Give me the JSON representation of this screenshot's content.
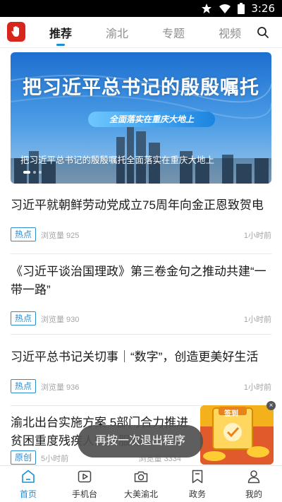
{
  "status_bar": {
    "time": "3:26"
  },
  "nav": {
    "tabs": [
      {
        "label": "推荐"
      },
      {
        "label": "渝北"
      },
      {
        "label": "专题"
      },
      {
        "label": "视频"
      }
    ],
    "active_tab": "推荐",
    "logo_icon": "red-hand-logo-icon",
    "search_icon": "search-icon"
  },
  "banner": {
    "headline": "把习近平总书记的殷殷嘱托",
    "ribbon": "全面落实在重庆大地上",
    "caption": "把习近平总书记的殷殷嘱托全面落实在重庆大地上"
  },
  "news": [
    {
      "title": "习近平就朝鲜劳动党成立75周年向金正恩致贺电",
      "tag": "热点",
      "views": "浏览量 925",
      "time": "1小时前"
    },
    {
      "title": "《习近平谈治国理政》第三卷金句之推动共建“一带一路”",
      "tag": "热点",
      "views": "浏览量 930",
      "time": "1小时前"
    },
    {
      "title": "习近平总书记关切事｜“数字”，创造更美好生活",
      "tag": "热点",
      "views": "浏览量 936",
      "time": "1小时前"
    },
    {
      "title": "渝北出台实施方案 5部门合力推进贫困重度残疾人照护服务",
      "tag": "原创",
      "views": "5小时前",
      "time": "浏览量 3334"
    }
  ],
  "ad": {
    "label": "签到",
    "close": "×"
  },
  "toast": {
    "text": "再按一次退出程序"
  },
  "bottom_nav": [
    {
      "label": "首页",
      "icon": "home-icon"
    },
    {
      "label": "手机台",
      "icon": "play-icon"
    },
    {
      "label": "大美渝北",
      "icon": "camera-icon"
    },
    {
      "label": "政务",
      "icon": "bookmark-icon"
    },
    {
      "label": "我的",
      "icon": "user-icon"
    }
  ],
  "colors": {
    "accent": "#1a8fd6",
    "tag": "#2a8bd0",
    "logo": "#d9261c"
  }
}
